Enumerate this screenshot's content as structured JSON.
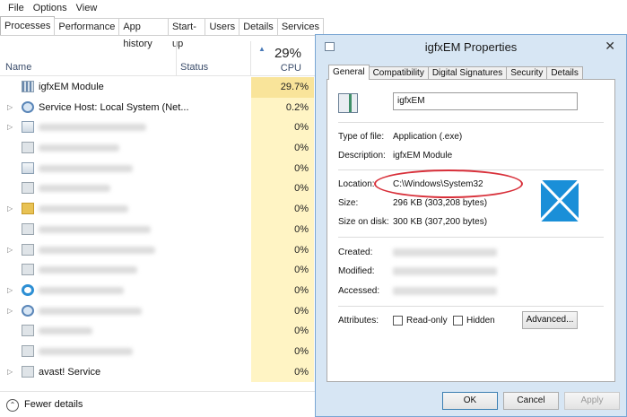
{
  "task_manager": {
    "menu": [
      "File",
      "Options",
      "View"
    ],
    "tabs": [
      "Processes",
      "Performance",
      "App history",
      "Start-up",
      "Users",
      "Details",
      "Services"
    ],
    "header": {
      "name": "Name",
      "status": "Status",
      "cpu_total": "29%",
      "cpu": "CPU"
    },
    "rows": [
      {
        "name": "igfxEM Module",
        "cpu": "29.7%",
        "icon": "igfx-icon",
        "expandable": false,
        "blurred": false
      },
      {
        "name": "Service Host: Local System (Net...",
        "cpu": "0.2%",
        "icon": "gear-icon",
        "expandable": true,
        "blurred": false
      },
      {
        "name": "",
        "cpu": "0%",
        "icon": "network-icon",
        "expandable": true,
        "blurred": true
      },
      {
        "name": "",
        "cpu": "0%",
        "icon": "window-icon",
        "expandable": false,
        "blurred": true
      },
      {
        "name": "",
        "cpu": "0%",
        "icon": "app-icon",
        "expandable": false,
        "blurred": true
      },
      {
        "name": "",
        "cpu": "0%",
        "icon": "window-icon",
        "expandable": false,
        "blurred": true
      },
      {
        "name": "",
        "cpu": "0%",
        "icon": "folder-icon",
        "expandable": true,
        "blurred": true
      },
      {
        "name": "",
        "cpu": "0%",
        "icon": "window-icon",
        "expandable": false,
        "blurred": true
      },
      {
        "name": "",
        "cpu": "0%",
        "icon": "window-icon",
        "expandable": true,
        "blurred": true
      },
      {
        "name": "",
        "cpu": "0%",
        "icon": "window-icon",
        "expandable": false,
        "blurred": true
      },
      {
        "name": "",
        "cpu": "0%",
        "icon": "ie-icon",
        "expandable": true,
        "blurred": true
      },
      {
        "name": "",
        "cpu": "0%",
        "icon": "gear-icon",
        "expandable": true,
        "blurred": true
      },
      {
        "name": "",
        "cpu": "0%",
        "icon": "window-icon",
        "expandable": false,
        "blurred": true
      },
      {
        "name": "",
        "cpu": "0%",
        "icon": "window-icon",
        "expandable": false,
        "blurred": true
      },
      {
        "name": "avast! Service",
        "cpu": "0%",
        "icon": "window-icon",
        "expandable": true,
        "blurred": false
      }
    ],
    "fewer_details": "Fewer details"
  },
  "dialog": {
    "title": "igfxEM Properties",
    "tabs": [
      "General",
      "Compatibility",
      "Digital Signatures",
      "Security",
      "Details"
    ],
    "file_name": "igfxEM",
    "type_label": "Type of file:",
    "type_value": "Application (.exe)",
    "desc_label": "Description:",
    "desc_value": "igfxEM Module",
    "location_label": "Location:",
    "location_value": "C:\\Windows\\System32",
    "size_label": "Size:",
    "size_value": "296 KB (303,208 bytes)",
    "size_disk_label": "Size on disk:",
    "size_disk_value": "300 KB (307,200 bytes)",
    "created_label": "Created:",
    "modified_label": "Modified:",
    "accessed_label": "Accessed:",
    "attributes_label": "Attributes:",
    "readonly_label": "Read-only",
    "hidden_label": "Hidden",
    "advanced_label": "Advanced...",
    "ok_label": "OK",
    "cancel_label": "Cancel",
    "apply_label": "Apply",
    "accent_color": "#d8303a"
  }
}
